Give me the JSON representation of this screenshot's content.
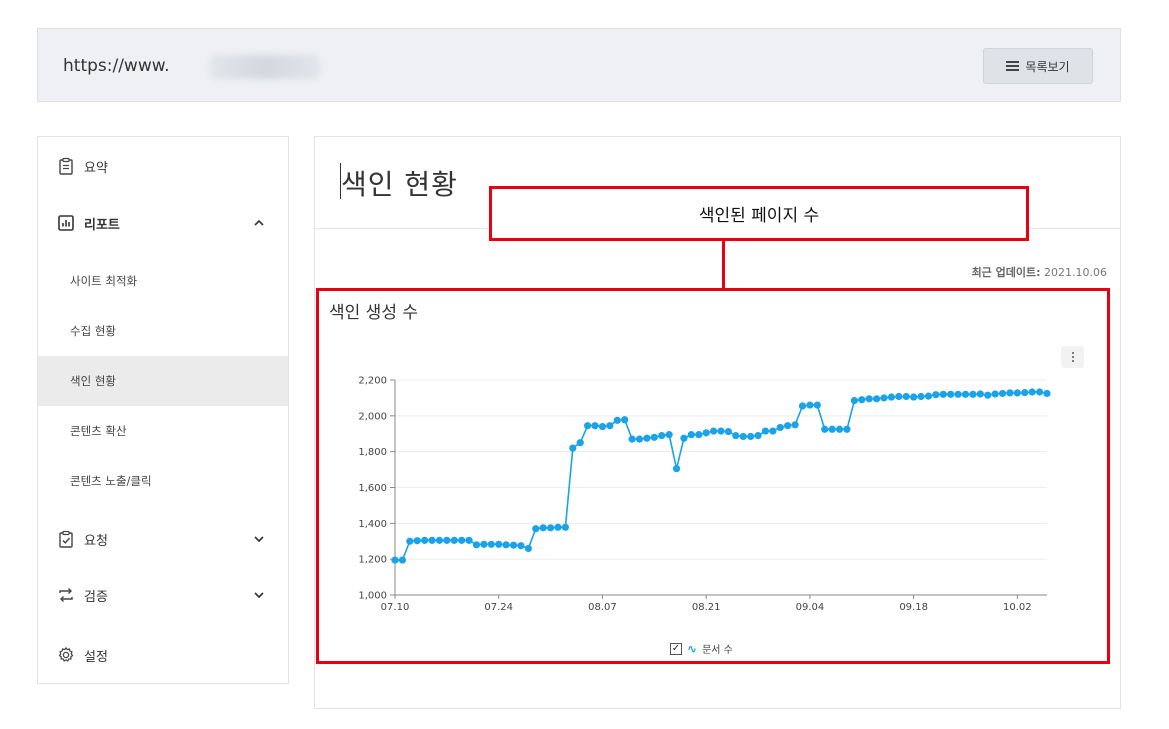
{
  "url": {
    "prefix": "https://www."
  },
  "header": {
    "list_button": "목록보기"
  },
  "sidebar": {
    "items": [
      {
        "label": "요약",
        "icon": "clipboard-icon"
      },
      {
        "label": "리포트",
        "icon": "bar-chart-icon",
        "expanded": true
      },
      {
        "label": "사이트 최적화"
      },
      {
        "label": "수집 현황"
      },
      {
        "label": "색인 현황",
        "active": true
      },
      {
        "label": "콘텐츠 확산"
      },
      {
        "label": "콘텐츠 노출/클릭"
      },
      {
        "label": "요청",
        "icon": "checklist-icon"
      },
      {
        "label": "검증",
        "icon": "swap-icon"
      },
      {
        "label": "설정",
        "icon": "gear-icon"
      }
    ]
  },
  "main": {
    "title": "색인 현황",
    "update_label": "최근 업데이트:",
    "update_date": "2021.10.06"
  },
  "annotation": {
    "text": "색인된 페이지 수",
    "color": "#e60012"
  },
  "chart_data": {
    "type": "line",
    "title": "색인 생성 수",
    "ylim": [
      1000,
      2200
    ],
    "yticks": [
      1000,
      1200,
      1400,
      1600,
      1800,
      2000,
      2200
    ],
    "ytick_labels": [
      "1,000",
      "1,200",
      "1,400",
      "1,600",
      "1,800",
      "2,000",
      "2,200"
    ],
    "xticks": [
      "07.10",
      "07.24",
      "08.07",
      "08.21",
      "09.04",
      "09.18",
      "10.02"
    ],
    "xtick_index": [
      0,
      14,
      28,
      42,
      56,
      70,
      84
    ],
    "grid": true,
    "color": "#1aa3e8",
    "legend": "bottom",
    "series": [
      {
        "name": "문서 수",
        "values": [
          1195,
          1195,
          1300,
          1303,
          1305,
          1305,
          1305,
          1305,
          1305,
          1305,
          1305,
          1280,
          1283,
          1283,
          1283,
          1280,
          1278,
          1275,
          1260,
          1370,
          1375,
          1375,
          1378,
          1378,
          1820,
          1850,
          1945,
          1945,
          1940,
          1945,
          1975,
          1978,
          1870,
          1870,
          1875,
          1880,
          1890,
          1895,
          1705,
          1875,
          1895,
          1895,
          1905,
          1915,
          1915,
          1912,
          1890,
          1885,
          1885,
          1890,
          1915,
          1915,
          1935,
          1945,
          1950,
          2055,
          2060,
          2060,
          1925,
          1925,
          1925,
          1925,
          2085,
          2090,
          2095,
          2095,
          2100,
          2105,
          2108,
          2108,
          2105,
          2108,
          2110,
          2118,
          2120,
          2120,
          2120,
          2120,
          2120,
          2122,
          2115,
          2122,
          2125,
          2128,
          2128,
          2130,
          2133,
          2133,
          2125
        ]
      }
    ]
  }
}
